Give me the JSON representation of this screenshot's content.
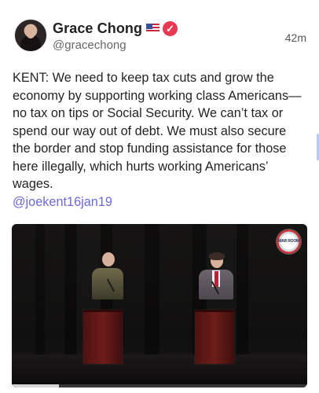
{
  "post": {
    "author": {
      "display_name": "Grace Chong",
      "handle": "@gracechong",
      "flag_icon": "us-flag-icon",
      "verified_icon": "verified-check-icon"
    },
    "timestamp": "42m",
    "text": "KENT: We need to keep tax cuts and grow the economy by supporting working class Americans—no tax on tips or Social Security. We can’t tax or spend our way out of debt. We must also secure the border and stop funding assistance for those here illegally, which hurts working Americans’ wages.",
    "mention": "@joekent16jan19",
    "video": {
      "badge_text": "WAR ROOM",
      "progress_fraction": 0.16
    }
  },
  "colors": {
    "mention": "#6c6ad6",
    "verified": "#e93853",
    "text": "#242424",
    "secondary_text": "#666666"
  }
}
